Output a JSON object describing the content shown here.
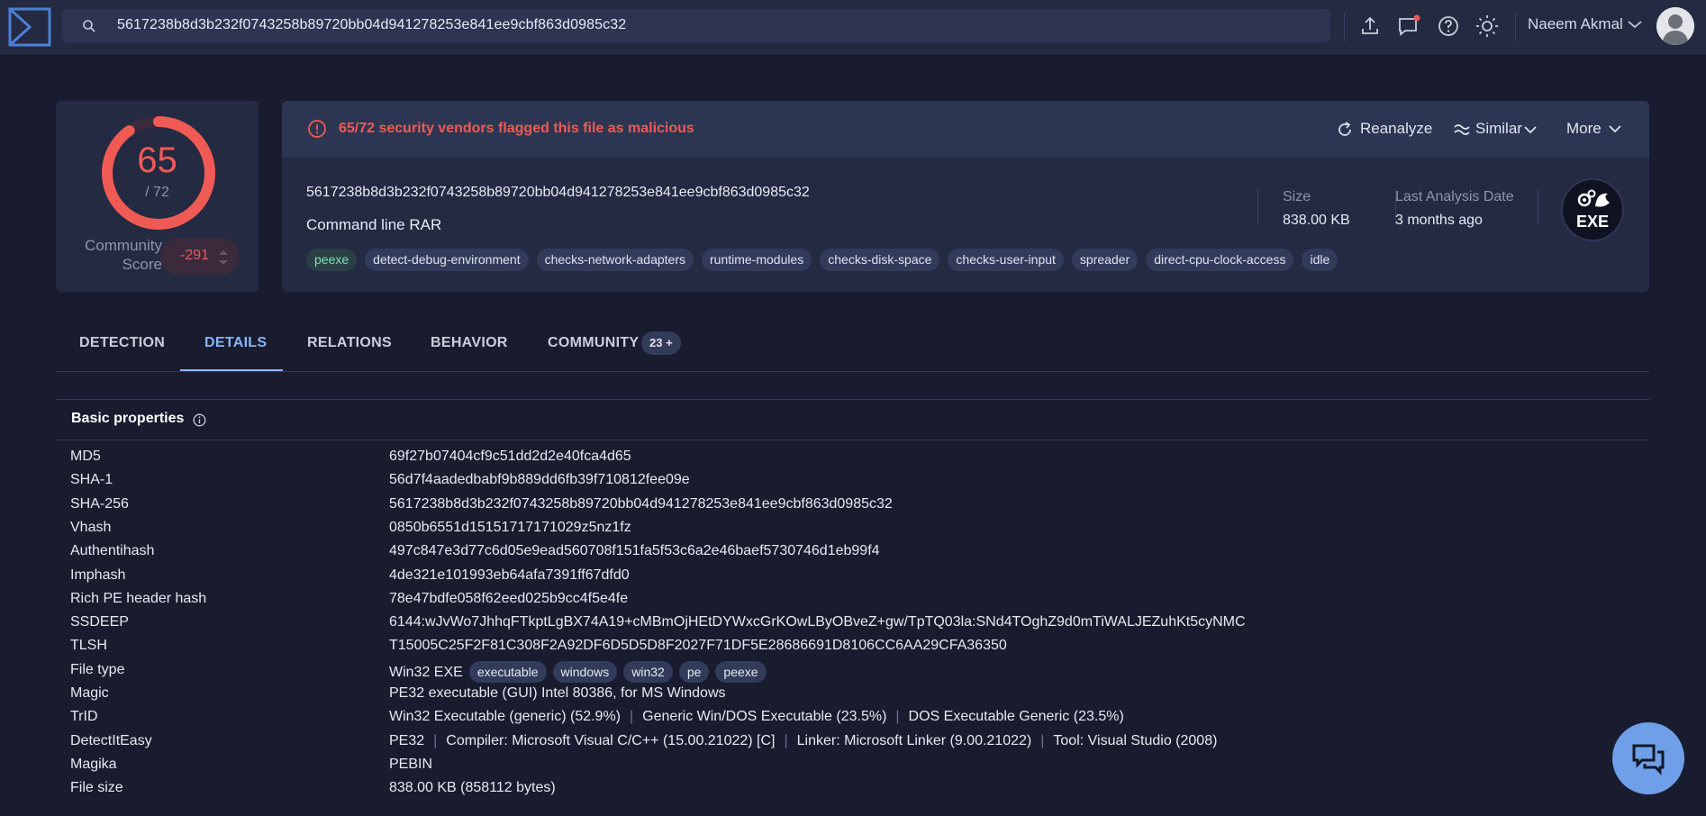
{
  "search": {
    "value": "5617238b8d3b232f0743258b89720bb04d941278253e841ee9cbf863d0985c32"
  },
  "user": {
    "name": "Naeem Akmal"
  },
  "score": {
    "detected": "65",
    "total": "/ 72",
    "detected_fraction": 0.9028,
    "community_label": "Community Score",
    "community_value": "-291"
  },
  "alert": {
    "text": "65/72 security vendors flagged this file as malicious"
  },
  "actions": {
    "reanalyze": "Reanalyze",
    "similar": "Similar",
    "more": "More"
  },
  "file": {
    "hash": "5617238b8d3b232f0743258b89720bb04d941278253e841ee9cbf863d0985c32",
    "name": "Command line RAR",
    "tags": [
      "peexe",
      "detect-debug-environment",
      "checks-network-adapters",
      "runtime-modules",
      "checks-disk-space",
      "checks-user-input",
      "spreader",
      "direct-cpu-clock-access",
      "idle"
    ],
    "size_label": "Size",
    "size_value": "838.00 KB",
    "date_label": "Last Analysis Date",
    "date_value": "3 months ago",
    "type_badge": "EXE"
  },
  "tabs": {
    "detection": "DETECTION",
    "details": "DETAILS",
    "relations": "RELATIONS",
    "behavior": "BEHAVIOR",
    "community": "COMMUNITY",
    "community_count": "23 +"
  },
  "details": {
    "title": "Basic properties",
    "rows": [
      {
        "k": "MD5",
        "v": "69f27b07404cf9c51dd2d2e40fca4d65"
      },
      {
        "k": "SHA-1",
        "v": "56d7f4aadedbabf9b889dd6fb39f710812fee09e"
      },
      {
        "k": "SHA-256",
        "v": "5617238b8d3b232f0743258b89720bb04d941278253e841ee9cbf863d0985c32"
      },
      {
        "k": "Vhash",
        "v": "0850b6551d15151717171029z5nz1fz"
      },
      {
        "k": "Authentihash",
        "v": "497c847e3d77c6d05e9ead560708f151fa5f53c6a2e46baef5730746d1eb99f4"
      },
      {
        "k": "Imphash",
        "v": "4de321e101993eb64afa7391ff67dfd0"
      },
      {
        "k": "Rich PE header hash",
        "v": "78e47bdfe058f62eed025b9cc4f5e4fe"
      },
      {
        "k": "SSDEEP",
        "v": "6144:wJvWo7JhhqFTkptLgBX74A19+cMBmOjHEtDYWxcGrKOwLByOBveZ+gw/TpTQ03la:SNd4TOghZ9d0mTiWALJEZuhKt5cyNMC"
      },
      {
        "k": "TLSH",
        "v": "T15005C25F2F81C308F2A92DF6D5D5D8F2027F71DF5E28686691D8106CC6AA29CFA36350"
      },
      {
        "k": "File type",
        "v": "Win32 EXE",
        "tags": [
          "executable",
          "windows",
          "win32",
          "pe",
          "peexe"
        ]
      },
      {
        "k": "Magic",
        "v": "PE32 executable (GUI) Intel 80386, for MS Windows"
      },
      {
        "k": "TrID",
        "parts": [
          "Win32 Executable (generic) (52.9%)",
          "Generic Win/DOS Executable (23.5%)",
          "DOS Executable Generic (23.5%)"
        ]
      },
      {
        "k": "DetectItEasy",
        "parts": [
          "PE32",
          "Compiler: Microsoft Visual C/C++ (15.00.21022) [C]",
          "Linker: Microsoft Linker (9.00.21022)",
          "Tool: Visual Studio (2008)"
        ]
      },
      {
        "k": "Magika",
        "v": "PEBIN"
      },
      {
        "k": "File size",
        "v": "838.00 KB (858112 bytes)"
      }
    ]
  },
  "colors": {
    "bg": "#181c2e",
    "panel": "#232a42",
    "danger": "#f05a55",
    "accent": "#8ab4f8",
    "fab": "#6f9fe8"
  },
  "icons": [
    "logo-icon",
    "search-icon",
    "upload-icon",
    "chat-notification-icon",
    "help-icon",
    "theme-icon",
    "chevron-down-icon",
    "alert-circle-icon",
    "reanalyze-icon",
    "similar-icon",
    "gear-icon",
    "info-icon",
    "chat-bubbles-icon"
  ]
}
